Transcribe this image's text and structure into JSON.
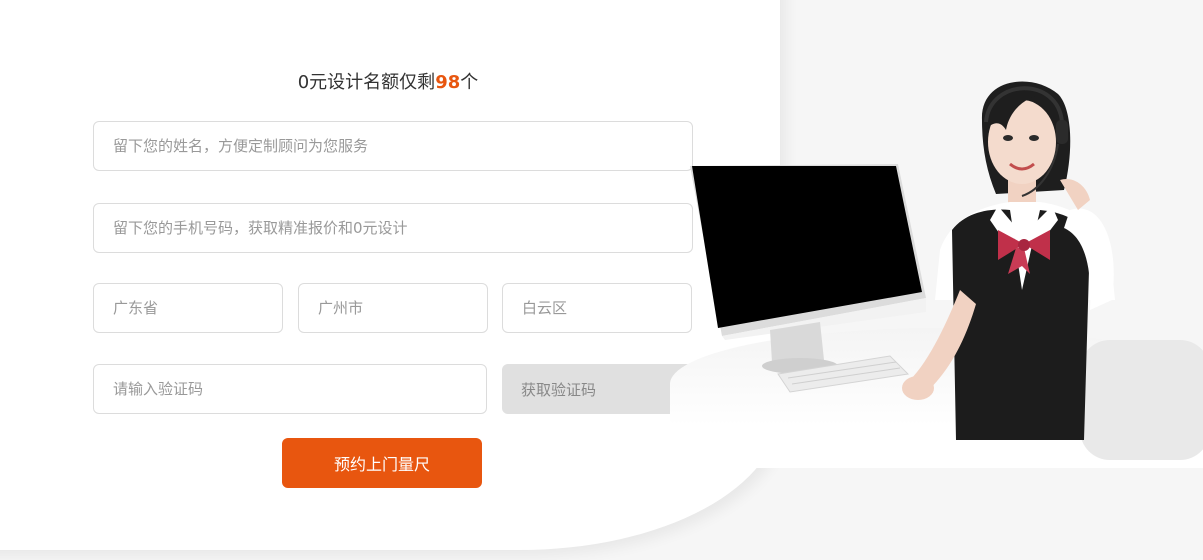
{
  "form": {
    "title_prefix": "0元设计名额仅剩",
    "title_count": "98",
    "title_suffix": "个",
    "name_placeholder": "留下您的姓名，方便定制顾问为您服务",
    "phone_placeholder": "留下您的手机号码，获取精准报价和0元设计",
    "province": "广东省",
    "city": "广州市",
    "district": "白云区",
    "code_placeholder": "请输入验证码",
    "get_code_label": "获取验证码",
    "submit_label": "预约上门量尺"
  },
  "colors": {
    "accent": "#e8560f",
    "field_border": "#dcdcdc",
    "placeholder": "#999999",
    "disabled_button": "#e0e0e0"
  },
  "illustration": {
    "subject": "customer-service-agent",
    "props": [
      "computer-monitor",
      "keyboard",
      "headset"
    ]
  }
}
